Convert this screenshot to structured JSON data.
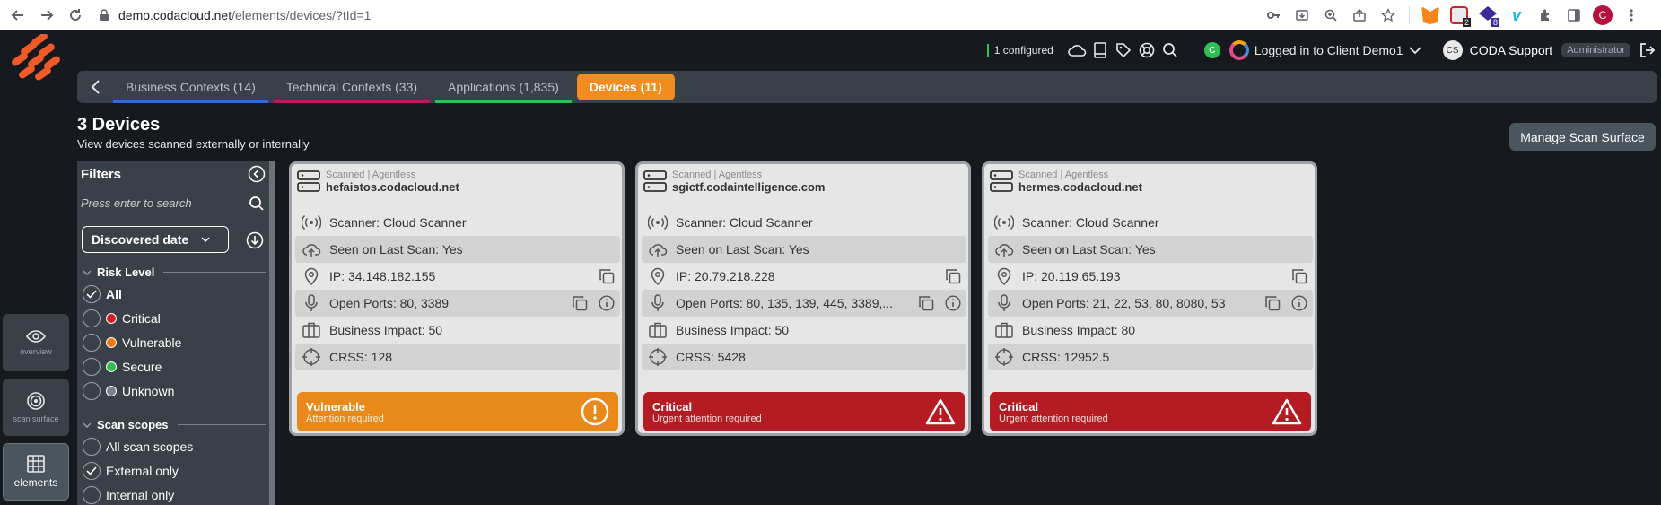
{
  "browser": {
    "url_host": "demo.codacloud.net",
    "url_path": "/elements/devices/?tId=1",
    "ext_badges": [
      "2",
      "8"
    ],
    "profile_initial": "C"
  },
  "header": {
    "configured": "1 configured",
    "client_badge": "C",
    "logged_in": "Logged in to Client Demo1",
    "user_initials": "CS",
    "user_name": "CODA Support",
    "role": "Administrator"
  },
  "tabs": [
    {
      "label": "Business Contexts (14)",
      "color": "#2a6fd6"
    },
    {
      "label": "Technical Contexts (33)",
      "color": "#c2185b"
    },
    {
      "label": "Applications (1,835)",
      "color": "#2fbf52"
    },
    {
      "label": "Devices (11)",
      "color": "#f28c1e"
    }
  ],
  "page": {
    "title": "3 Devices",
    "subtitle": "View devices scanned externally or internally",
    "manage_button": "Manage Scan Surface"
  },
  "left_nav": [
    {
      "label": "overview"
    },
    {
      "label": "scan surface"
    },
    {
      "label": "elements"
    }
  ],
  "filters": {
    "title": "Filters",
    "search_placeholder": "Press enter to search",
    "sort_select": "Discovered date",
    "risk_section": "Risk Level",
    "risk_options": [
      {
        "label": "All",
        "checked": true
      },
      {
        "label": "Critical",
        "color": "#d01f2a"
      },
      {
        "label": "Vulnerable",
        "color": "#f07a12"
      },
      {
        "label": "Secure",
        "color": "#2fbf52"
      },
      {
        "label": "Unknown",
        "color": "#7a838a"
      }
    ],
    "scope_section": "Scan scopes",
    "scope_options": [
      {
        "label": "All scan scopes"
      },
      {
        "label": "External only",
        "checked": true
      },
      {
        "label": "Internal only"
      }
    ]
  },
  "devices": [
    {
      "scanned": "Scanned | Agentless",
      "hostname": "hefaistos.codacloud.net",
      "scanner": "Scanner: Cloud Scanner",
      "seen": "Seen on Last Scan: Yes",
      "ip": "IP: 34.148.182.155",
      "ports": "Open Ports: 80, 3389",
      "impact": "Business Impact: 50",
      "crss": "CRSS: 128",
      "status": "Vulnerable",
      "status_sub": "Attention required"
    },
    {
      "scanned": "Scanned | Agentless",
      "hostname": "sgictf.codaintelligence.com",
      "scanner": "Scanner: Cloud Scanner",
      "seen": "Seen on Last Scan: Yes",
      "ip": "IP: 20.79.218.228",
      "ports": "Open Ports: 80, 135, 139, 445, 3389,...",
      "impact": "Business Impact: 50",
      "crss": "CRSS: 5428",
      "status": "Critical",
      "status_sub": "Urgent attention required"
    },
    {
      "scanned": "Scanned | Agentless",
      "hostname": "hermes.codacloud.net",
      "scanner": "Scanner: Cloud Scanner",
      "seen": "Seen on Last Scan: Yes",
      "ip": "IP: 20.119.65.193",
      "ports": "Open Ports: 21, 22, 53, 80, 8080, 53",
      "impact": "Business Impact: 80",
      "crss": "CRSS: 12952.5",
      "status": "Critical",
      "status_sub": "Urgent attention required"
    }
  ],
  "colors": {
    "accent": "#f28c1e",
    "critical": "#b51b23",
    "vulnerable": "#e8891a"
  }
}
